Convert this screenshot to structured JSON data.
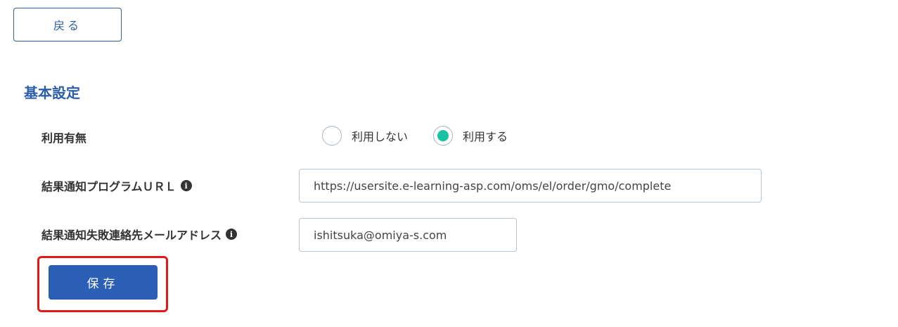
{
  "back_button": {
    "label": "戻る"
  },
  "section": {
    "title": "基本設定"
  },
  "fields": {
    "usage": {
      "label": "利用有無",
      "options": [
        {
          "label": "利用しない",
          "selected": false
        },
        {
          "label": "利用する",
          "selected": true
        }
      ]
    },
    "result_url": {
      "label": "結果通知プログラムＵＲＬ",
      "value": "https://usersite.e-learning-asp.com/oms/el/order/gmo/complete"
    },
    "failure_email": {
      "label": "結果通知失敗連絡先メールアドレス",
      "value": "ishitsuka@omiya-s.com"
    }
  },
  "save_button": {
    "label": "保存"
  },
  "colors": {
    "primary": "#2a5fb5",
    "radio_selected": "#19c2a0",
    "highlight": "#e01919"
  }
}
